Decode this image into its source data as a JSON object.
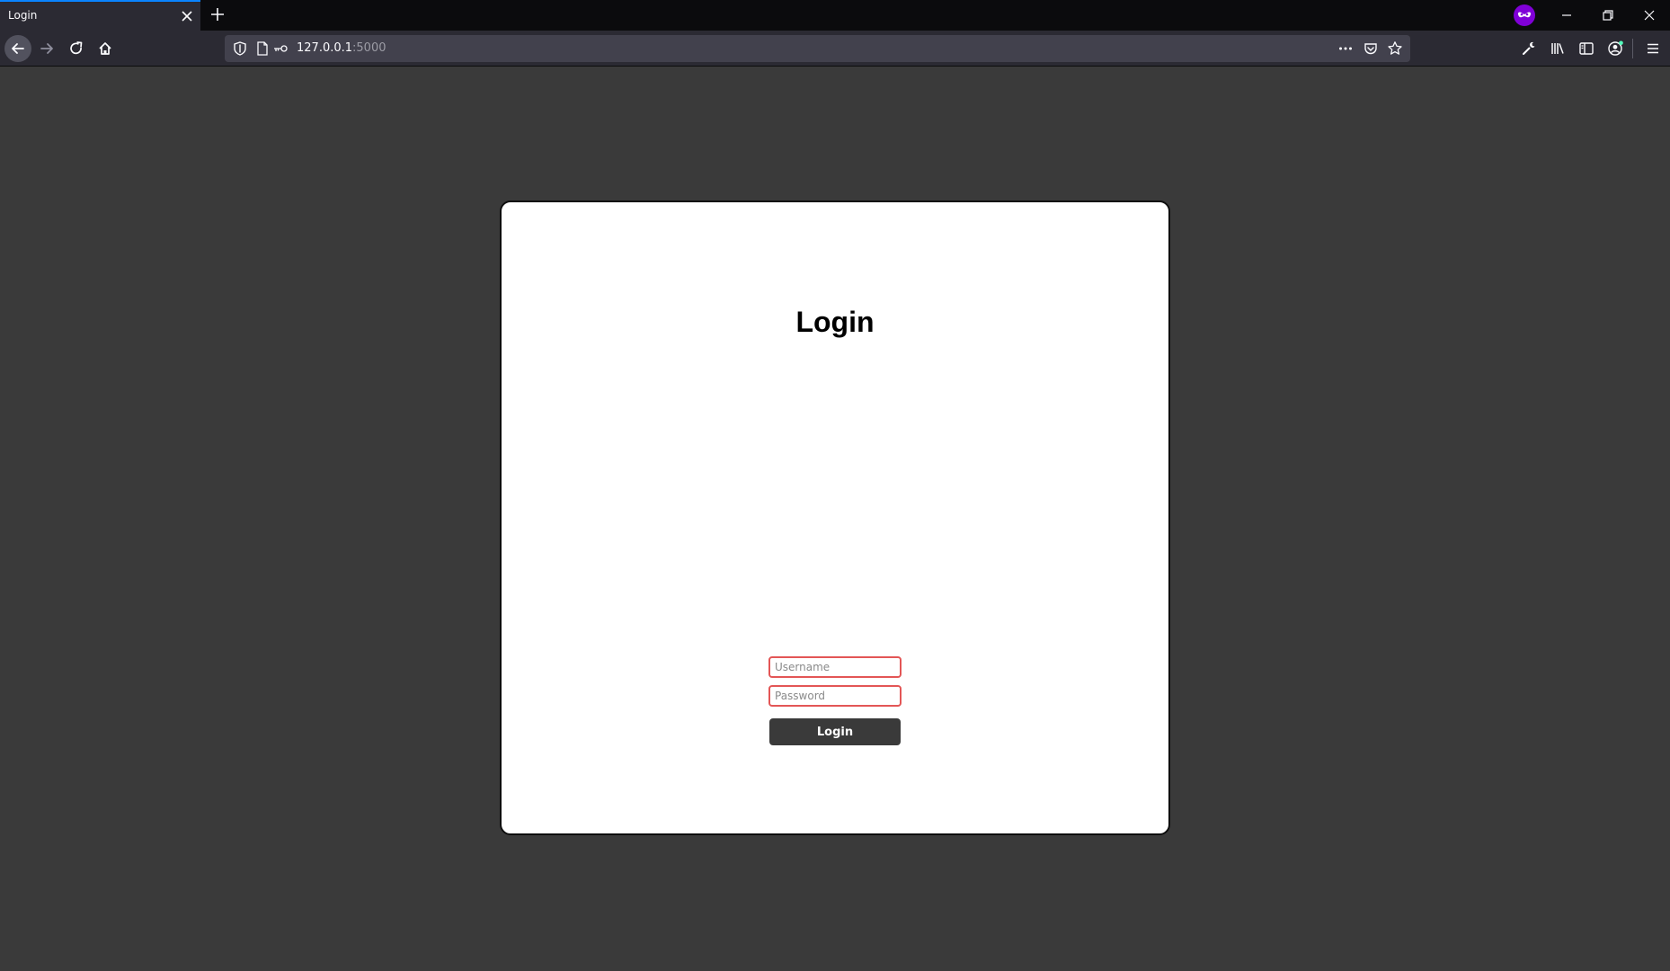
{
  "browser": {
    "tab": {
      "title": "Login"
    },
    "urlbar": {
      "host": "127.0.0.1",
      "port": ":5000"
    },
    "private_mode": true,
    "accent_color": "#0a84ff",
    "private_badge_color": "#8000d7"
  },
  "page": {
    "title": "Login",
    "username": {
      "placeholder": "Username",
      "value": ""
    },
    "password": {
      "placeholder": "Password",
      "value": ""
    },
    "submit_label": "Login",
    "field_border_color": "#e35656",
    "button_color": "#3a3a3a"
  }
}
